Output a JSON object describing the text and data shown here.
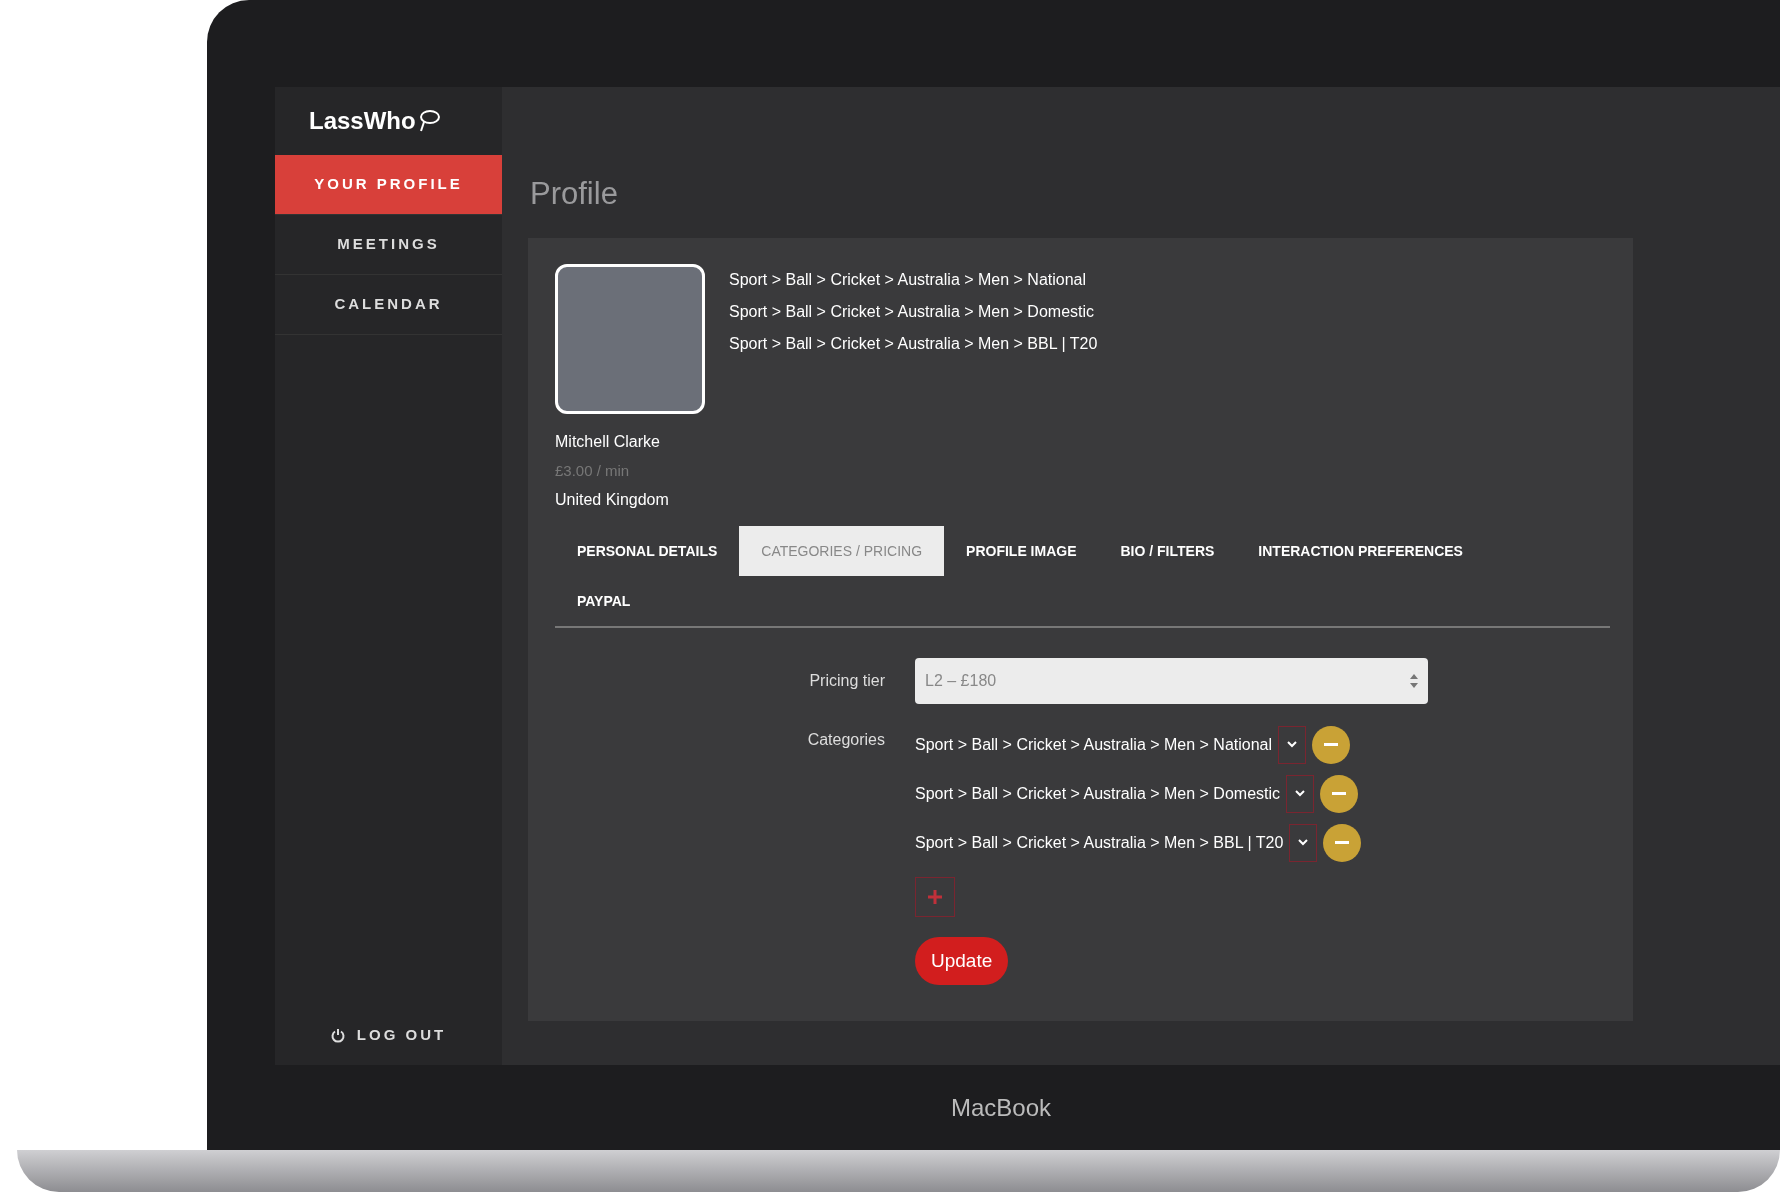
{
  "app": {
    "logo": "LassWho"
  },
  "sidebar": {
    "items": [
      {
        "label": "YOUR PROFILE",
        "selected": true
      },
      {
        "label": "MEETINGS",
        "selected": false
      },
      {
        "label": "CALENDAR",
        "selected": false
      }
    ],
    "logout": "LOG OUT"
  },
  "page_title": "Profile",
  "profile": {
    "name": "Mitchell Clarke",
    "rate": "£3.00 / min",
    "country": "United Kingdom",
    "categories": [
      "Sport > Ball > Cricket > Australia > Men > National",
      "Sport > Ball > Cricket > Australia > Men > Domestic",
      "Sport > Ball > Cricket > Australia > Men > BBL | T20"
    ]
  },
  "tabs": [
    {
      "label": "PERSONAL DETAILS",
      "selected": false
    },
    {
      "label": "CATEGORIES / PRICING",
      "selected": true
    },
    {
      "label": "PROFILE IMAGE",
      "selected": false
    },
    {
      "label": "BIO / FILTERS",
      "selected": false
    },
    {
      "label": "INTERACTION PREFERENCES",
      "selected": false
    },
    {
      "label": "PAYPAL",
      "selected": false
    }
  ],
  "form": {
    "pricing_label": "Pricing tier",
    "pricing_value": "L2 – £180",
    "categories_label": "Categories",
    "categories": [
      "Sport > Ball > Cricket > Australia > Men > National",
      "Sport > Ball > Cricket > Australia > Men > Domestic",
      "Sport > Ball > Cricket > Australia > Men > BBL | T20"
    ],
    "update": "Update"
  },
  "device_label": "MacBook"
}
